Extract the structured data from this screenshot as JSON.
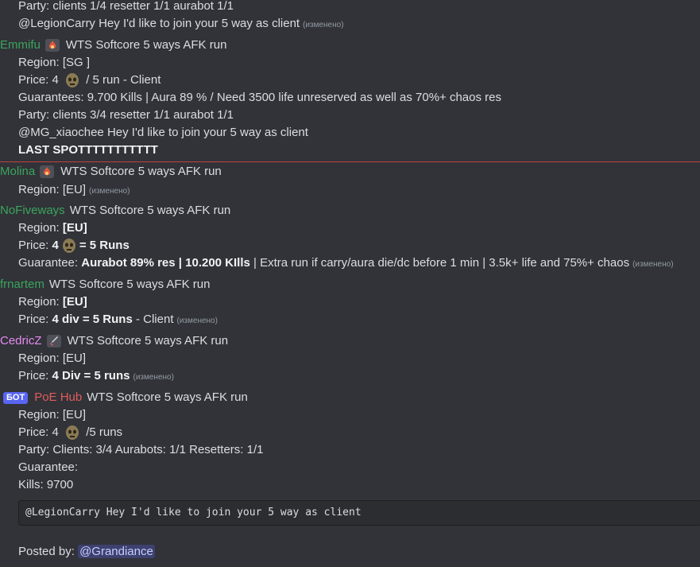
{
  "messages": {
    "m0": {
      "party": "Party: clients 1/4 resetter 1/1 aurabot 1/1",
      "join": "@LegionCarry Hey I'd like to join your 5 way as client",
      "edited": "(изменено)"
    },
    "m1": {
      "author": "Emmifu",
      "author_color": "#3ba55d",
      "title": "WTS Softcore 5 ways AFK run",
      "region": "Region: [SG ]",
      "price_pre": "Price:  4",
      "price_post": "/ 5 run - Client",
      "guarantees": "Guarantees:  9.700 Kills | Aura 89 % / Need 3500 life unreserved as well as 70%+ chaos res",
      "party": "Party: clients 3/4 resetter 1/1 aurabot 1/1",
      "join": "@MG_xiaochee Hey I'd like to join your 5 way as client",
      "last_spot": "LAST SPOTTTTTTTTTTT"
    },
    "m2": {
      "author": "Molina",
      "author_color": "#3ba55d",
      "title": "WTS Softcore 5 ways AFK run",
      "region": "Region: [EU]",
      "edited": "(изменено)"
    },
    "m3": {
      "author": "NoFiveways",
      "author_color": "#3ba55d",
      "title": "WTS Softcore 5 ways AFK run",
      "region_label": "Region:",
      "region_value": "[EU]",
      "price_label": "Price:",
      "price_pre": "4",
      "price_post": "= 5  Runs",
      "guarantee_label": "Guarantee:",
      "guarantee_bold": "Aurabot 89% res | 10.200 KIlls",
      "guarantee_rest": "|  Extra run if carry/aura die/dc before 1 min |  3.5k+ life and 75%+ chaos",
      "edited": "(изменено)"
    },
    "m4": {
      "author": "frnartem",
      "author_color": "#3ba55d",
      "title": "WTS Softcore 5 ways AFK run",
      "region_label": "Region:",
      "region_value": "[EU]",
      "price_label": "Price:",
      "price_bold": "4 div = 5 Runs",
      "price_rest": "- Client",
      "edited": "(изменено)"
    },
    "m5": {
      "author": "CedricZ",
      "author_color": "#e78bf2",
      "title": "WTS Softcore 5 ways AFK run",
      "region": "Region: [EU]",
      "price_label": "Price:",
      "price_bold": "4 Div = 5 runs",
      "edited": "(изменено)"
    },
    "m6": {
      "bot_badge": "БОТ",
      "author": "PoE Hub",
      "author_color": "#e05c5c",
      "title": "WTS Softcore 5 ways AFK run",
      "region": "Region: [EU]",
      "price_pre": "Price: 4",
      "price_post": "/5 runs",
      "party": "Party: Clients: 3/4 Aurabots: 1/1 Resetters: 1/1",
      "guarantee": "Guarantee:",
      "kills": "Kills: 9700",
      "code": "@LegionCarry Hey I'd like to join your 5 way as client",
      "posted_by_label": "Posted by:",
      "posted_by_mention": "@Grandiance"
    }
  }
}
